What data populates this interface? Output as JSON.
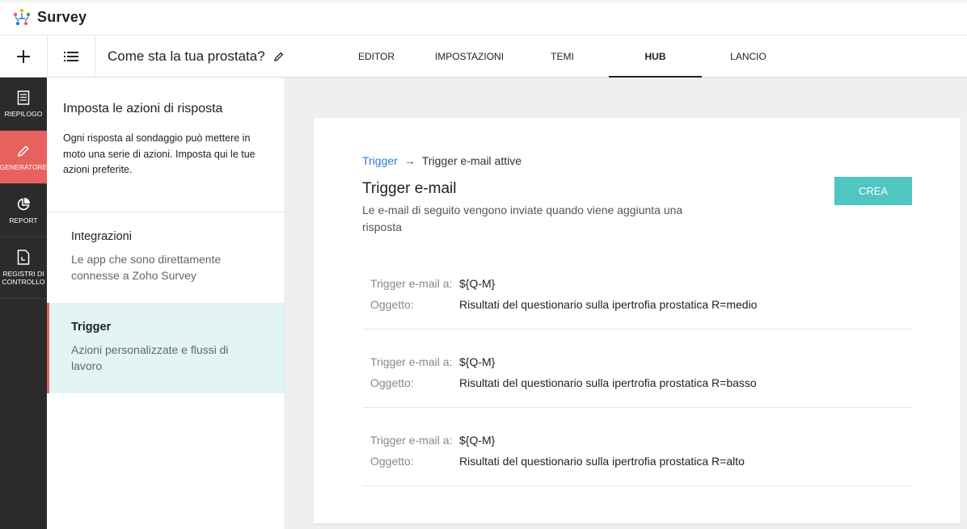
{
  "brand": {
    "name": "Survey"
  },
  "header": {
    "survey_title": "Come sta la tua prostata?",
    "tabs": [
      {
        "label": "EDITOR"
      },
      {
        "label": "IMPOSTAZIONI"
      },
      {
        "label": "TEMI"
      },
      {
        "label": "HUB",
        "active": true
      },
      {
        "label": "LANCIO"
      }
    ]
  },
  "rail": {
    "items": [
      {
        "label": "RIEPILOGO",
        "icon": "document-icon"
      },
      {
        "label": "GENERATORE",
        "icon": "pencil-icon",
        "active": true
      },
      {
        "label": "REPORT",
        "icon": "pie-chart-icon"
      },
      {
        "label_line1": "REGISTRI DI",
        "label_line2": "CONTROLLO",
        "icon": "log-file-icon"
      }
    ]
  },
  "middle": {
    "title": "Imposta le azioni di risposta",
    "description": "Ogni risposta al sondaggio può mettere in moto una serie di azioni. Imposta qui le tue azioni preferite.",
    "items": [
      {
        "title": "Integrazioni",
        "description": "Le app che sono direttamente connesse a Zoho Survey"
      },
      {
        "title": "Trigger",
        "description": "Azioni personalizzate e flussi di lavoro",
        "active": true
      }
    ]
  },
  "content": {
    "breadcrumb": {
      "link": "Trigger",
      "arrow": "→",
      "current": "Trigger e-mail attive"
    },
    "title": "Trigger e-mail",
    "subtitle": "Le e-mail di seguito vengono inviate quando viene aggiunta una risposta",
    "create_label": "CREA",
    "triggers": [
      {
        "to_label": "Trigger e-mail a:",
        "to_value": "${Q-M}",
        "subject_label": "Oggetto:",
        "subject_value": "Risultati del questionario sulla ipertrofia prostatica R=medio"
      },
      {
        "to_label": "Trigger e-mail a:",
        "to_value": "${Q-M}",
        "subject_label": "Oggetto:",
        "subject_value": "Risultati del questionario sulla ipertrofia prostatica R=basso"
      },
      {
        "to_label": "Trigger e-mail a:",
        "to_value": "${Q-M}",
        "subject_label": "Oggetto:",
        "subject_value": "Risultati del questionario sulla ipertrofia prostatica R=alto"
      }
    ]
  },
  "colors": {
    "accent_red": "#e7615f",
    "accent_teal": "#4fc6c2",
    "link_blue": "#2f7ad1",
    "active_item_bg": "#e2f4f3"
  }
}
